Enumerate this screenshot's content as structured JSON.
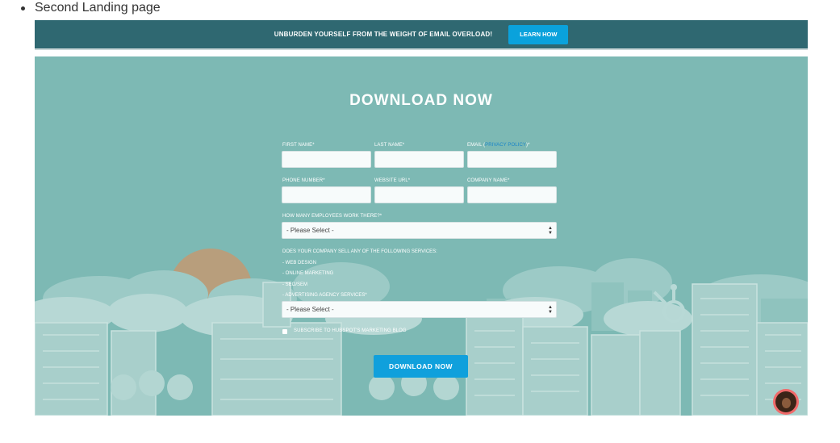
{
  "doc": {
    "bullet_text": "Second Landing page"
  },
  "topbar": {
    "message": "UNBURDEN YOURSELF FROM THE WEIGHT OF EMAIL OVERLOAD!",
    "button_label": "LEARN HOW",
    "bg_color": "#2f6871",
    "button_color": "#0aa2dc"
  },
  "hero": {
    "title": "DOWNLOAD NOW",
    "bg_color": "#7db9b4"
  },
  "form": {
    "first_name_label": "FIRST NAME*",
    "last_name_label": "LAST NAME*",
    "email_label_prefix": "EMAIL (",
    "privacy_policy_label": "PRIVACY POLICY",
    "email_label_suffix": ")*",
    "phone_label": "PHONE NUMBER*",
    "website_label": "WEBSITE URL*",
    "company_label": "COMPANY NAME*",
    "employees_label": "HOW MANY EMPLOYEES WORK THERE?*",
    "employees_selected": "- Please Select -",
    "services_lines": [
      "DOES YOUR COMPANY SELL ANY OF THE FOLLOWING SERVICES:",
      "- WEB DESIGN",
      "- ONLINE MARKETING",
      "- SEO/SEM",
      "- ADVERTISING AGENCY SERVICES*"
    ],
    "services_selected": "- Please Select -",
    "subscribe_label": "SUBSCRIBE TO HUBSPOT'S MARKETING BLOG",
    "submit_label": "DOWNLOAD NOW"
  },
  "icons": {
    "chat_avatar": "avatar-icon",
    "select_arrows": "updown-arrows-icon"
  }
}
